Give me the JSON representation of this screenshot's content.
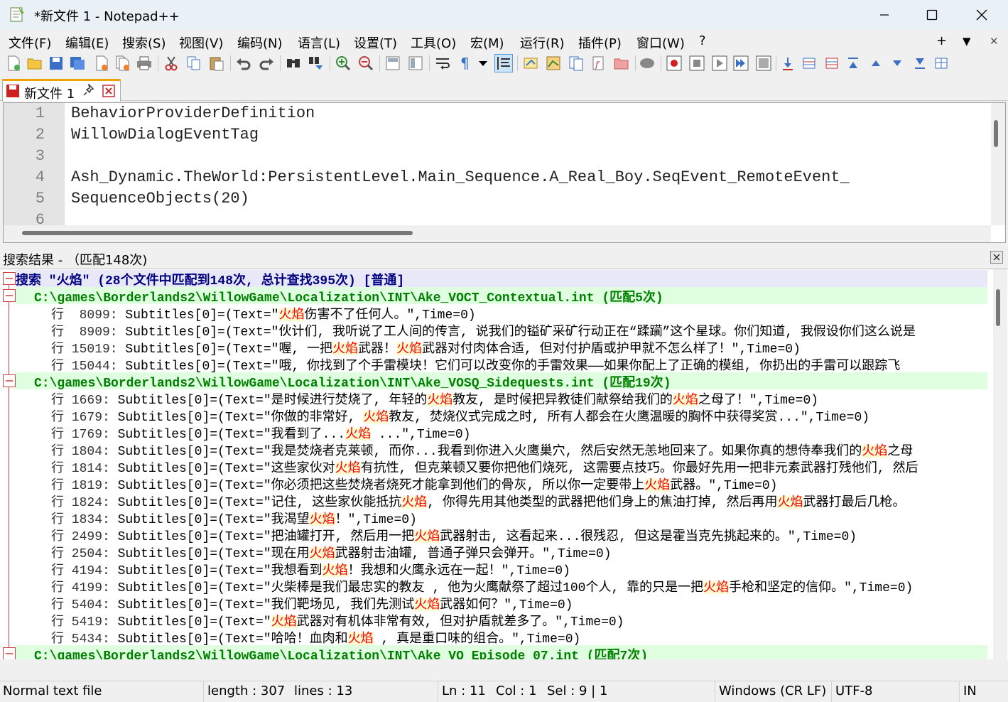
{
  "window": {
    "title": "*新文件 1 - Notepad++",
    "minimize": "─",
    "maximize": "☐",
    "close": "✕"
  },
  "menu": [
    "文件(F)",
    "编辑(E)",
    "搜索(S)",
    "视图(V)",
    "编码(N)",
    "语言(L)",
    "设置(T)",
    "工具(O)",
    "宏(M)",
    "运行(R)",
    "插件(P)",
    "窗口(W)",
    "?"
  ],
  "menu_right": {
    "add": "+",
    "dropdown": "▼",
    "close": "✕"
  },
  "tab": {
    "label": "新文件 1",
    "pin": "📌",
    "close": "✖"
  },
  "editor": {
    "lines": [
      {
        "n": "1",
        "text": "BehaviorProviderDefinition"
      },
      {
        "n": "2",
        "text": "WillowDialogEventTag"
      },
      {
        "n": "3",
        "text": ""
      },
      {
        "n": "4",
        "text": "Ash_Dynamic.TheWorld:PersistentLevel.Main_Sequence.A_Real_Boy.SeqEvent_RemoteEvent_"
      },
      {
        "n": "5",
        "text": "SequenceObjects(20)"
      },
      {
        "n": "6",
        "text": ""
      }
    ]
  },
  "search_results": {
    "header": "搜索结果 - （匹配148次)",
    "close": "✕",
    "summary": "搜索 \"火焰\" (28个文件中匹配到148次, 总计查找395次) [普通]",
    "groups": [
      {
        "file": "C:\\games\\Borderlands2\\WillowGame\\Localization\\INT\\Ake_VOCT_Contextual.int (匹配5次)",
        "rows": [
          {
            "prefix": "行  8099: ",
            "parts": [
              "Subtitles[0]=(Text=\"",
              "火焰",
              "伤害不了任何人。\",Time=0)"
            ]
          },
          {
            "prefix": "行  8909: ",
            "parts": [
              "Subtitles[0]=(Text=\"伙计们, 我听说了工人间的传言, 说我们的镒矿采矿行动正在“蹂躏”这个星球。你们知道, 我假设你们这么说是"
            ]
          },
          {
            "prefix": "行 15019: ",
            "parts": [
              "Subtitles[0]=(Text=\"喔, 一把",
              "火焰",
              "武器！",
              "火焰",
              "武器对付肉体合适, 但对付护盾或护甲就不怎么样了！\",Time=0)"
            ]
          },
          {
            "prefix": "行 15044: ",
            "parts": [
              "Subtitles[0]=(Text=\"哦, 你找到了个手雷模块！它们可以改变你的手雷效果——如果你配上了正确的模组, 你扔出的手雷可以跟踪飞"
            ]
          }
        ]
      },
      {
        "file": "C:\\games\\Borderlands2\\WillowGame\\Localization\\INT\\Ake_VOSQ_Sidequests.int (匹配19次)",
        "rows": [
          {
            "prefix": "行 1669: ",
            "parts": [
              "Subtitles[0]=(Text=\"是时候进行焚烧了, 年轻的",
              "火焰",
              "教友, 是时候把异教徒们献祭给我们的",
              "火焰",
              "之母了！\",Time=0)"
            ]
          },
          {
            "prefix": "行 1679: ",
            "parts": [
              "Subtitles[0]=(Text=\"你做的非常好, ",
              "火焰",
              "教友, 焚烧仪式完成之时, 所有人都会在火鹰温暖的胸怀中获得奖赏...\",Time=0)"
            ]
          },
          {
            "prefix": "行 1769: ",
            "parts": [
              "Subtitles[0]=(Text=\"我看到了...",
              "火焰",
              " ...\",Time=0)"
            ]
          },
          {
            "prefix": "行 1804: ",
            "parts": [
              "Subtitles[0]=(Text=\"我是焚烧者克莱顿, 而你...我看到你进入火鹰巢穴, 然后安然无恙地回来了。如果你真的想侍奉我们的",
              "火焰",
              "之母"
            ]
          },
          {
            "prefix": "行 1814: ",
            "parts": [
              "Subtitles[0]=(Text=\"这些家伙对",
              "火焰",
              "有抗性, 但克莱顿又要你把他们烧死, 这需要点技巧。你最好先用一把非元素武器打残他们, 然后"
            ]
          },
          {
            "prefix": "行 1819: ",
            "parts": [
              "Subtitles[0]=(Text=\"你必须把这些焚烧者烧死才能拿到他们的骨灰, 所以你一定要带上",
              "火焰",
              "武器。\",Time=0)"
            ]
          },
          {
            "prefix": "行 1824: ",
            "parts": [
              "Subtitles[0]=(Text=\"记住, 这些家伙能抵抗",
              "火焰",
              ", 你得先用其他类型的武器把他们身上的焦油打掉, 然后再用",
              "火焰",
              "武器打最后几枪。"
            ]
          },
          {
            "prefix": "行 1834: ",
            "parts": [
              "Subtitles[0]=(Text=\"我渴望",
              "火焰",
              "！\",Time=0)"
            ]
          },
          {
            "prefix": "行 2499: ",
            "parts": [
              "Subtitles[0]=(Text=\"把油罐打开, 然后用一把",
              "火焰",
              "武器射击, 这看起来...很残忍, 但这是霍当克先挑起来的。\",Time=0)"
            ]
          },
          {
            "prefix": "行 2504: ",
            "parts": [
              "Subtitles[0]=(Text=\"现在用",
              "火焰",
              "武器射击油罐, 普通子弹只会弹开。\",Time=0)"
            ]
          },
          {
            "prefix": "行 4194: ",
            "parts": [
              "Subtitles[0]=(Text=\"我想看到",
              "火焰",
              "！我想和火鹰永远在一起！\",Time=0)"
            ]
          },
          {
            "prefix": "行 4199: ",
            "parts": [
              "Subtitles[0]=(Text=\"火柴棒是我们最忠实的教友 , 他为火鹰献祭了超过100个人, 靠的只是一把",
              "火焰",
              "手枪和坚定的信仰。\",Time=0)"
            ]
          },
          {
            "prefix": "行 5404: ",
            "parts": [
              "Subtitles[0]=(Text=\"我们靶场见, 我们先测试",
              "火焰",
              "武器如何？\",Time=0)"
            ]
          },
          {
            "prefix": "行 5419: ",
            "parts": [
              "Subtitles[0]=(Text=\"",
              "火焰",
              "武器对有机体非常有效, 但对护盾就差多了。\",Time=0)"
            ]
          },
          {
            "prefix": "行 5434: ",
            "parts": [
              "Subtitles[0]=(Text=\"哈哈！血肉和",
              "火焰",
              " , 真是重口味的组合。\",Time=0)"
            ]
          }
        ]
      },
      {
        "file": "C:\\games\\Borderlands2\\WillowGame\\Localization\\INT\\Ake_VO_Episode_07.int (匹配7次)",
        "rows": []
      }
    ]
  },
  "status": {
    "filetype": "Normal text file",
    "length": "length : 307",
    "lines": "lines : 13",
    "ln": "Ln : 11",
    "col": "Col : 1",
    "sel": "Sel : 9 | 1",
    "eol": "Windows (CR LF)",
    "encoding": "UTF-8",
    "ins": "IN"
  },
  "colors": {
    "match_fg": "#ff0000",
    "match_bg": "#fffbd0",
    "file_fg": "#008000",
    "file_bg": "#e0ffe0",
    "summary_fg": "#000080"
  }
}
